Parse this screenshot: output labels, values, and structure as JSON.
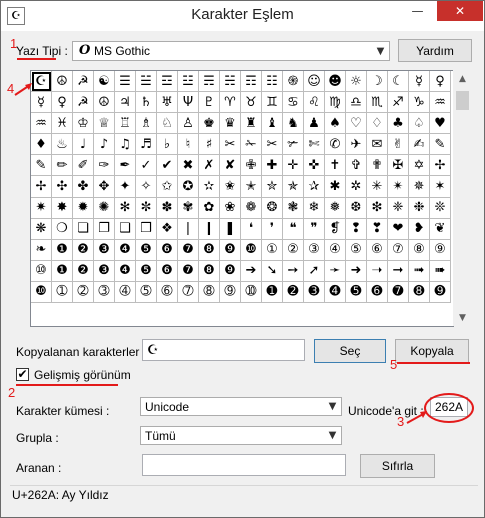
{
  "window": {
    "title": "Karakter Eşlem",
    "app_icon": "charmap-icon",
    "controls": {
      "minimize": "—",
      "maximize": "☐",
      "close": "✕"
    }
  },
  "font_row": {
    "label": "Yazı Tipi :",
    "selected_font": "MS Gothic",
    "font_type_glyph": "O",
    "help_button": "Yardım"
  },
  "grid": {
    "selected_char": "☪",
    "rows": [
      [
        "☪",
        "☮",
        "☭",
        "☯",
        "☰",
        "☱",
        "☲",
        "☳",
        "☴",
        "☵",
        "☶",
        "☷",
        "֍",
        "☺",
        "☻",
        "☼",
        "☽",
        "☾",
        "☿",
        "♀"
      ],
      [
        "☿",
        "♀",
        "☭",
        "☮",
        "♃",
        "♄",
        "♅",
        "Ψ",
        "♇",
        "♈",
        "♉",
        "♊",
        "♋",
        "♌",
        "♍",
        "♎",
        "♏",
        "♐",
        "♑",
        "♒"
      ],
      [
        "♒",
        "♓",
        "♔",
        "♕",
        "♖",
        "♗",
        "♘",
        "♙",
        "♚",
        "♛",
        "♜",
        "♝",
        "♞",
        "♟",
        "♠",
        "♡",
        "♢",
        "♣",
        "♤",
        "♥"
      ],
      [
        "♦",
        "♨",
        "♩",
        "♪",
        "♫",
        "♬",
        "♭",
        "♮",
        "♯",
        "✂",
        "✁",
        "✂",
        "✃",
        "✄",
        "✆",
        "✈",
        "✉",
        "✌",
        "✍",
        "✎"
      ],
      [
        "✎",
        "✏",
        "✐",
        "✑",
        "✒",
        "✓",
        "✔",
        "✖",
        "✗",
        "✘",
        "✙",
        "✚",
        "✛",
        "✜",
        "✝",
        "✞",
        "✟",
        "✠",
        "✡",
        "✢"
      ],
      [
        "✢",
        "✣",
        "✤",
        "✥",
        "✦",
        "✧",
        "✩",
        "✪",
        "✫",
        "✬",
        "✭",
        "✮",
        "✯",
        "✰",
        "✱",
        "✲",
        "✳",
        "✴",
        "✵",
        "✶"
      ],
      [
        "✷",
        "✸",
        "✹",
        "✺",
        "✻",
        "✼",
        "✽",
        "✾",
        "✿",
        "❀",
        "❁",
        "❂",
        "❃",
        "❄",
        "❅",
        "❆",
        "❇",
        "❈",
        "❉",
        "❊"
      ],
      [
        "❋",
        "❍",
        "❏",
        "❐",
        "❑",
        "❒",
        "❖",
        "❘",
        "❙",
        "❚",
        "❛",
        "❜",
        "❝",
        "❞",
        "❡",
        "❢",
        "❣",
        "❤",
        "❥",
        "❦"
      ],
      [
        "❧",
        "❶",
        "❷",
        "❸",
        "❹",
        "❺",
        "❻",
        "❼",
        "❽",
        "❾",
        "❿",
        "①",
        "②",
        "③",
        "④",
        "⑤",
        "⑥",
        "⑦",
        "⑧",
        "⑨"
      ],
      [
        "⑩",
        "❶",
        "❷",
        "❸",
        "❹",
        "❺",
        "❻",
        "❼",
        "❽",
        "❾",
        "➔",
        "➘",
        "➙",
        "➚",
        "➛",
        "➜",
        "➝",
        "➞",
        "➟",
        "➠"
      ],
      [
        "❿",
        "➀",
        "➁",
        "➂",
        "➃",
        "➄",
        "➅",
        "➆",
        "➇",
        "➈",
        "➉",
        "➊",
        "➋",
        "➌",
        "➍",
        "➎",
        "➏",
        "➐",
        "➑",
        "➒"
      ]
    ]
  },
  "copy_row": {
    "label": "Kopyalanan karakterler :",
    "value": "☪",
    "select_button": "Seç",
    "copy_button": "Kopyala"
  },
  "advanced": {
    "label": "Gelişmiş görünüm",
    "checked": true,
    "check_glyph": "✔"
  },
  "charset": {
    "label": "Karakter kümesi :",
    "value": "Unicode"
  },
  "goto_unicode": {
    "label": "Unicode'a git :",
    "value": "262A"
  },
  "group": {
    "label": "Grupla :",
    "value": "Tümü"
  },
  "search": {
    "label": "Aranan :",
    "value": "",
    "reset_button": "Sıfırla"
  },
  "status_bar": {
    "text": "U+262A: Ay Yıldız"
  },
  "annotations": {
    "n1": "1",
    "n2": "2",
    "n3": "3",
    "n4": "4",
    "n5": "5"
  },
  "colors": {
    "annotation": "#e31a1a",
    "close_button": "#c7302b"
  }
}
